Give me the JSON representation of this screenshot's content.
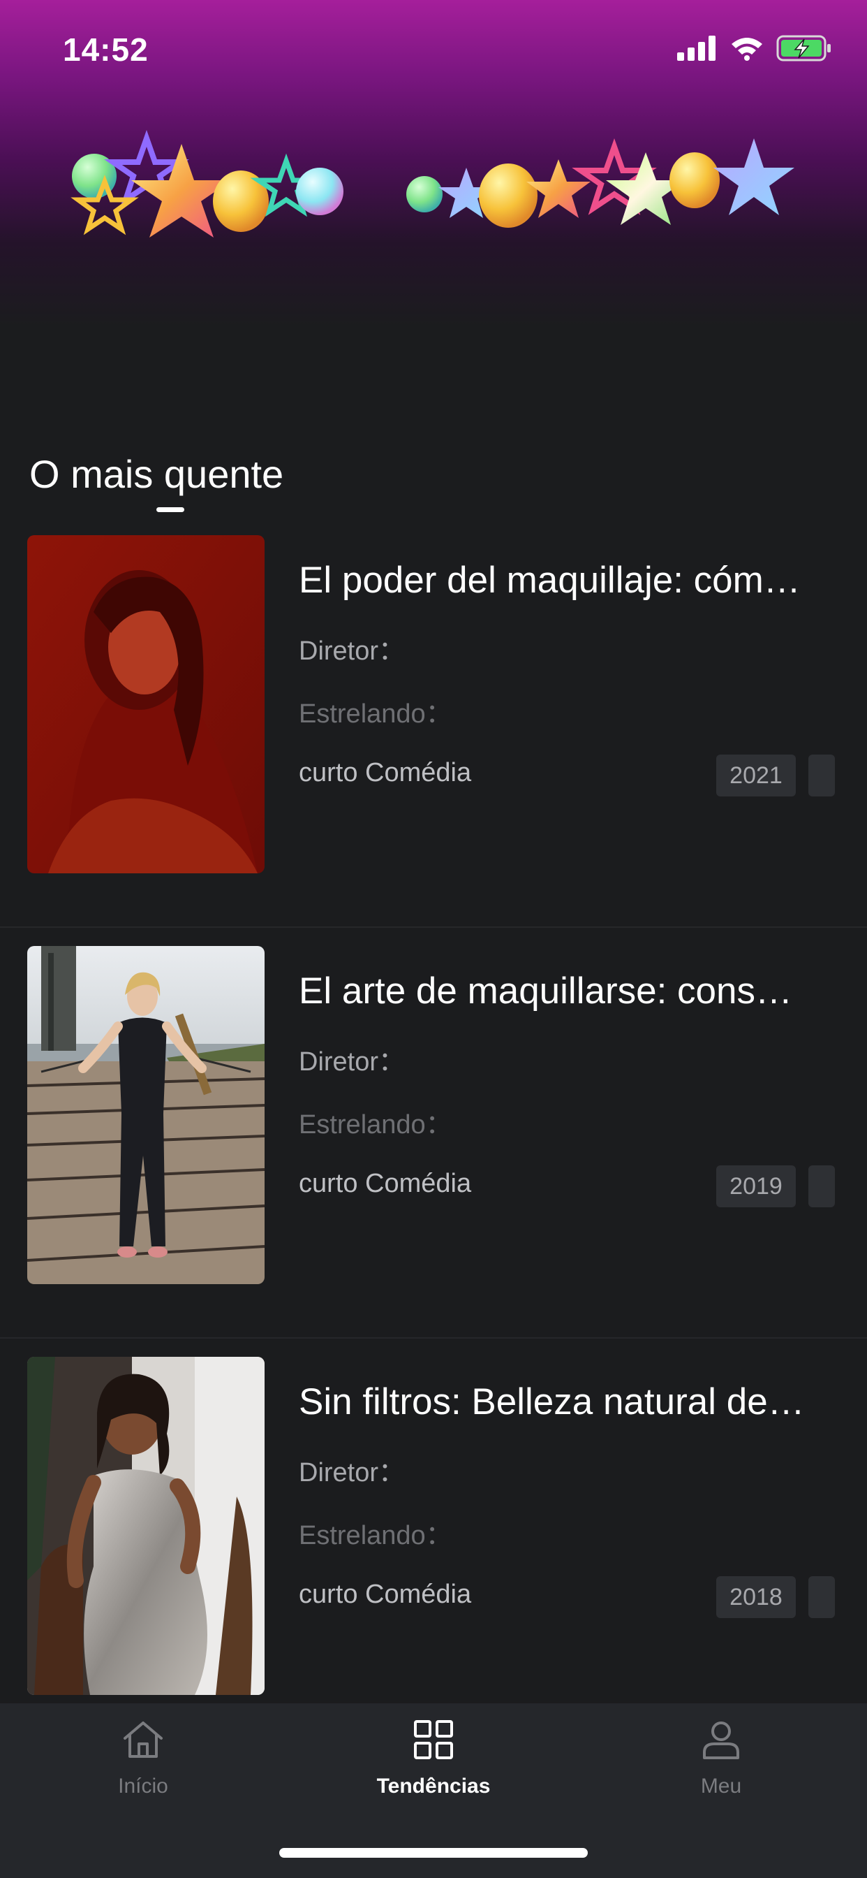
{
  "status_bar": {
    "time": "14:52"
  },
  "section": {
    "title": "O mais quente"
  },
  "items": [
    {
      "title": "El poder del maquillaje: cóm…",
      "director_label": "Diretor：",
      "cast_label": "Estrelando：",
      "genre": "curto Comédia",
      "year": "2021"
    },
    {
      "title": "El arte de maquillarse: cons…",
      "director_label": "Diretor：",
      "cast_label": "Estrelando：",
      "genre": "curto Comédia",
      "year": "2019"
    },
    {
      "title": "Sin filtros: Belleza natural de…",
      "director_label": "Diretor：",
      "cast_label": "Estrelando：",
      "genre": "curto Comédia",
      "year": "2018"
    }
  ],
  "tabbar": {
    "tabs": [
      {
        "label": "Início",
        "icon": "home-icon"
      },
      {
        "label": "Tendências",
        "icon": "grid-icon"
      },
      {
        "label": "Meu",
        "icon": "user-icon"
      }
    ],
    "active": "Tendências"
  },
  "colors": {
    "background": "#1b1c1e",
    "banner_top": "#a51f9b",
    "tabbar": "#25272b",
    "badge": "#2e3034",
    "battery_green": "#4cd964"
  }
}
